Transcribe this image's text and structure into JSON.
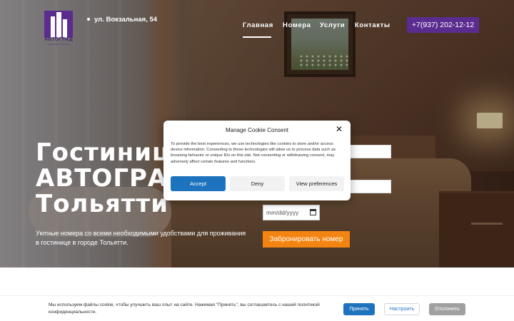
{
  "header": {
    "logo_text": "АВТОГРАД",
    "logo_subtext": "гостиница в Тольятти",
    "address": "ул. Вокзальная, 54",
    "nav": [
      {
        "label": "Главная",
        "active": true
      },
      {
        "label": "Номера",
        "active": false
      },
      {
        "label": "Услуги",
        "active": false
      },
      {
        "label": "Контакты",
        "active": false
      }
    ],
    "phone": "+7(937) 202-12-12",
    "accent_color": "#5b2c8f"
  },
  "hero": {
    "title_line1": "Гостиница",
    "title_line2": "АВТОГРАД",
    "title_line3": "Тольятти",
    "subtitle": "Уютные номера со всеми необходимыми удобствами для проживания в гостинице в городе Тольятти."
  },
  "booking": {
    "date_placeholder": "mm/dd/yyyy",
    "submit_label": "Забронировать номер",
    "button_color": "#f48411"
  },
  "cookie_modal": {
    "title": "Manage Cookie Consent",
    "text": "To provide the best experiences, we use technologies like cookies to store and/or access device information. Consenting to these technologies will allow us to process data such as browsing behavior or unique IDs on this site. Not consenting or withdrawing consent, may adversely affect certain features and functions.",
    "accept_label": "Accept",
    "deny_label": "Deny",
    "preferences_label": "View preferences",
    "close_icon": "close-icon"
  },
  "cookie_bar": {
    "text": "Мы используем файлы cookie, чтобы улучшить ваш опыт на сайте. Нажимая \"Принять\", вы соглашаетесь с нашей политикой конфиденциальности.",
    "accept_label": "Принять",
    "settings_label": "Настроить",
    "reject_label": "Отклонить"
  }
}
